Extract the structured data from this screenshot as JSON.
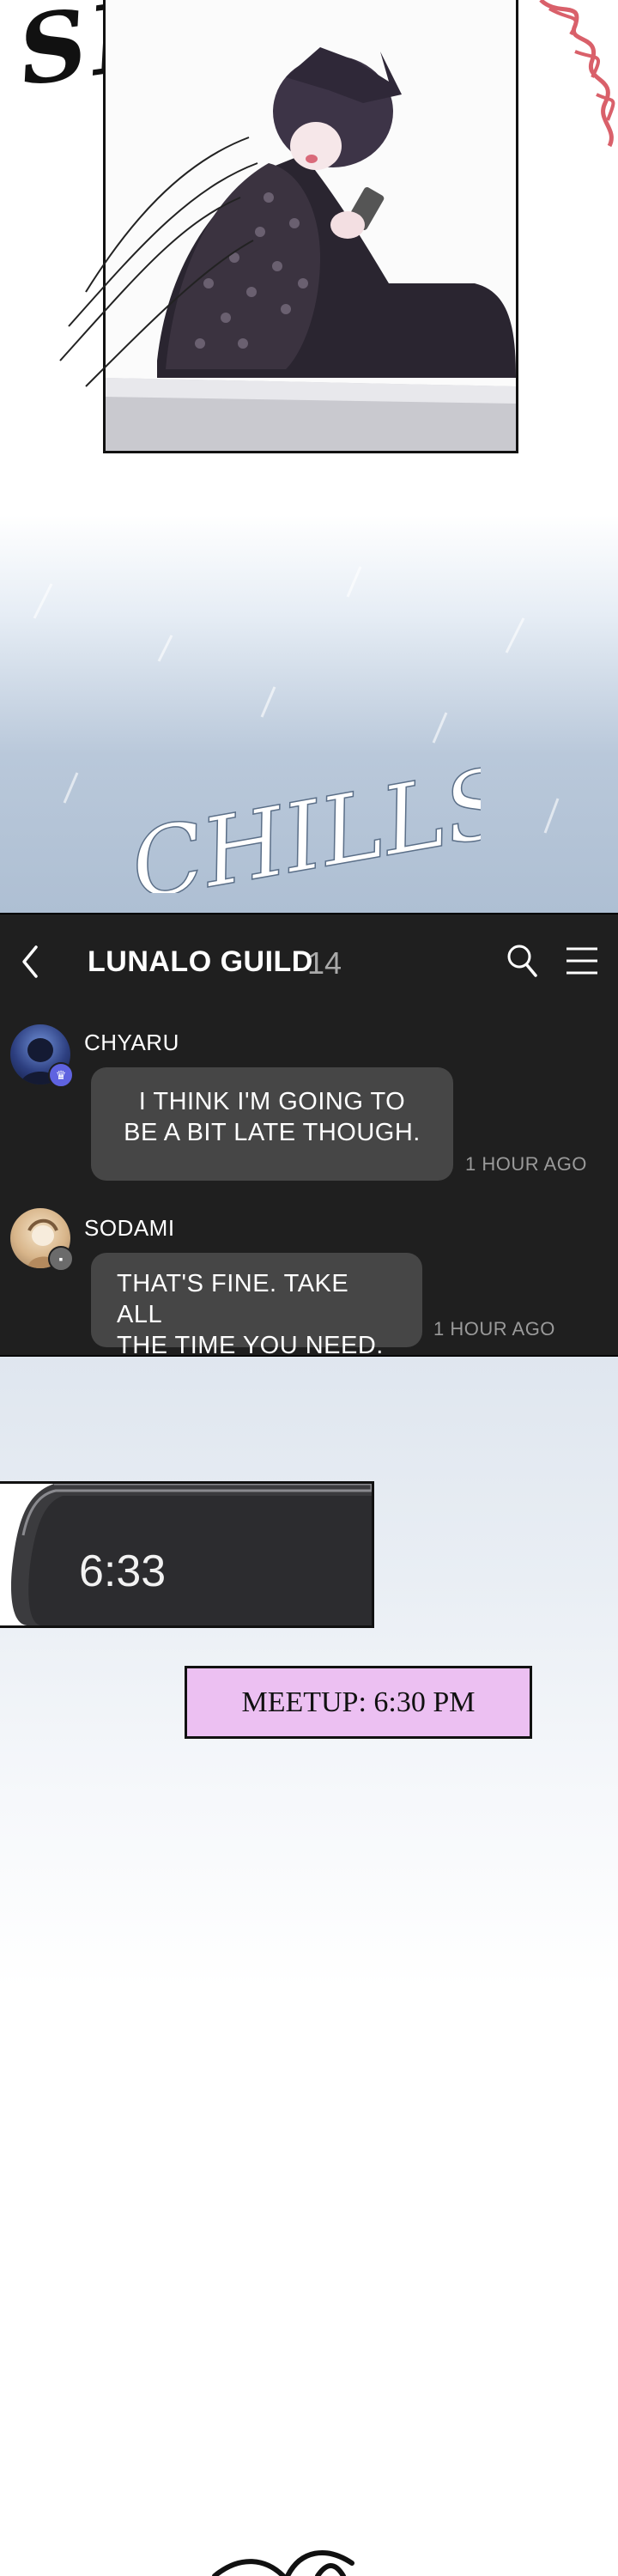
{
  "comic": {
    "top_sfx": "SPRING",
    "sky_sfx": "CHILLS",
    "bottom_sfx": "",
    "meetup_caption": "MEETUP: 6:30 PM",
    "phone_clock": "6:33"
  },
  "chat": {
    "back_icon": "chevron-left-icon",
    "title": "LUNALO GUILD",
    "member_count": "14",
    "search_icon": "search-icon",
    "menu_icon": "menu-icon",
    "messages": [
      {
        "username": "CHYARU",
        "text_line1": "I THINK I'M GOING TO",
        "text_line2": "BE A BIT LATE THOUGH.",
        "time": "1 HOUR AGO",
        "badge_icon": "crown-icon",
        "badge_color": "#5f63e0"
      },
      {
        "username": "SODAMI",
        "text_line1": "THAT'S FINE. TAKE ALL",
        "text_line2": "THE TIME YOU NEED.",
        "time": "1 HOUR AGO",
        "badge_icon": "grid-icon",
        "badge_color": "#6b6b6b"
      }
    ]
  },
  "colors": {
    "chat_bg": "#1f1f1f",
    "bubble_bg": "#464646",
    "caption_bg": "#ecc0f2"
  }
}
